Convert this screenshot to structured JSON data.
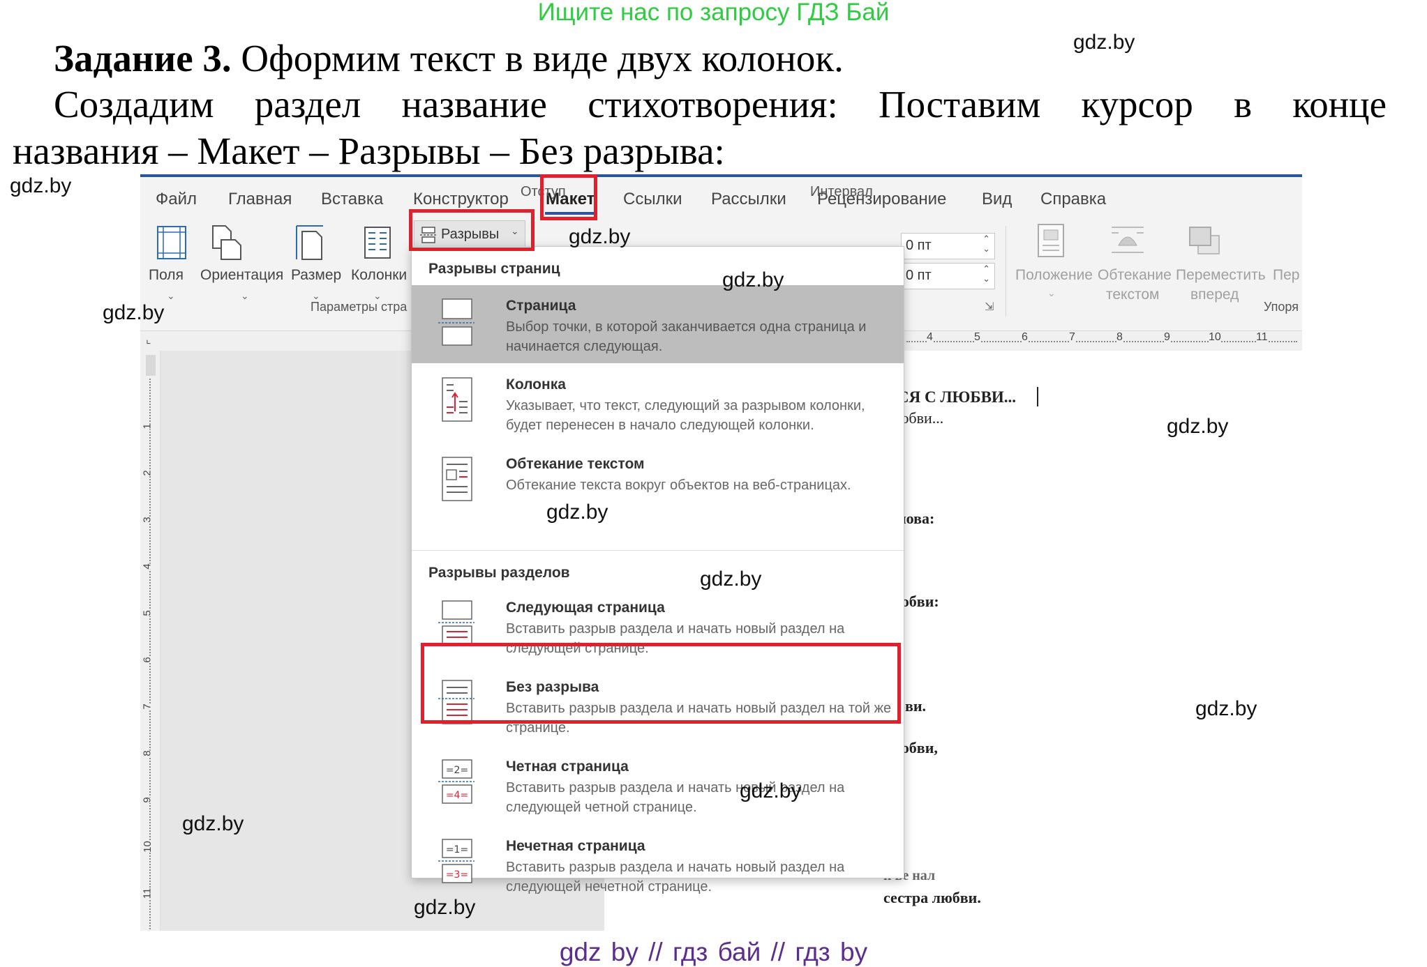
{
  "header_note": "Ищите нас по запросу ГДЗ Бай",
  "task": {
    "heading": "Задание 3.",
    "heading_rest": "Оформим текст в виде двух колонок.",
    "line2": "Создадим раздел название стихотворения: Поставим курсор в конце",
    "line3": "названия – Макет – Разрывы – Без разрыва:"
  },
  "watermark": "gdz.by",
  "footer": "gdz by  //  гдз бай  //  гдз by",
  "app": {
    "tabs": [
      "Файл",
      "Главная",
      "Вставка",
      "Конструктор",
      "Макет",
      "Ссылки",
      "Рассылки",
      "Рецензирование",
      "Вид",
      "Справка"
    ],
    "active_tab": "Макет",
    "ribbon": {
      "buttons": [
        "Поля",
        "Ориентация",
        "Размер",
        "Колонки"
      ],
      "breaks_button": "Разрывы",
      "indent_label": "Отступ",
      "interval_label": "Интервал",
      "spacing_before": "0 пт",
      "spacing_after": "0 пт",
      "group_label": "Параметры стра",
      "arrange_group": "Упоря",
      "arrange_buttons": [
        {
          "l1": "Положение",
          "l2": ""
        },
        {
          "l1": "Обтекание",
          "l2": "текстом"
        },
        {
          "l1": "Переместить",
          "l2": "вперед"
        },
        {
          "l1": "Пер",
          "l2": ""
        }
      ]
    },
    "ruler_numbers": [
      "4",
      "5",
      "6",
      "7",
      "8",
      "9",
      "10",
      "11"
    ],
    "vruler_numbers": [
      "1",
      "2",
      "3",
      "4",
      "5",
      "6",
      "7",
      "8",
      "9",
      "10",
      "11"
    ],
    "document_lines": [
      "СЯ С ЛЮБВИ...",
      "юбви...",
      "нова:",
      "юбви:",
      "бви.",
      "юбви,",
      "и ве нал",
      "сестра любви."
    ],
    "menu": {
      "section1": "Разрывы страниц",
      "section2": "Разрывы разделов",
      "items": [
        {
          "title": "Страница",
          "desc": "Выбор точки, в которой заканчивается одна страница и начинается следующая."
        },
        {
          "title": "Колонка",
          "desc": "Указывает, что текст, следующий за разрывом колонки, будет перенесен в начало следующей колонки."
        },
        {
          "title": "Обтекание текстом",
          "desc": "Обтекание текста вокруг объектов на веб-страницах."
        },
        {
          "title": "Следующая страница",
          "desc": "Вставить разрыв раздела и начать новый раздел на следующей странице."
        },
        {
          "title": "Без разрыва",
          "desc": "Вставить разрыв раздела и начать новый раздел на той же странице."
        },
        {
          "title": "Четная страница",
          "desc": "Вставить разрыв раздела и начать новый раздел на следующей четной странице."
        },
        {
          "title": "Нечетная страница",
          "desc": "Вставить разрыв раздела и начать новый раздел на следующей нечетной странице."
        }
      ]
    }
  }
}
